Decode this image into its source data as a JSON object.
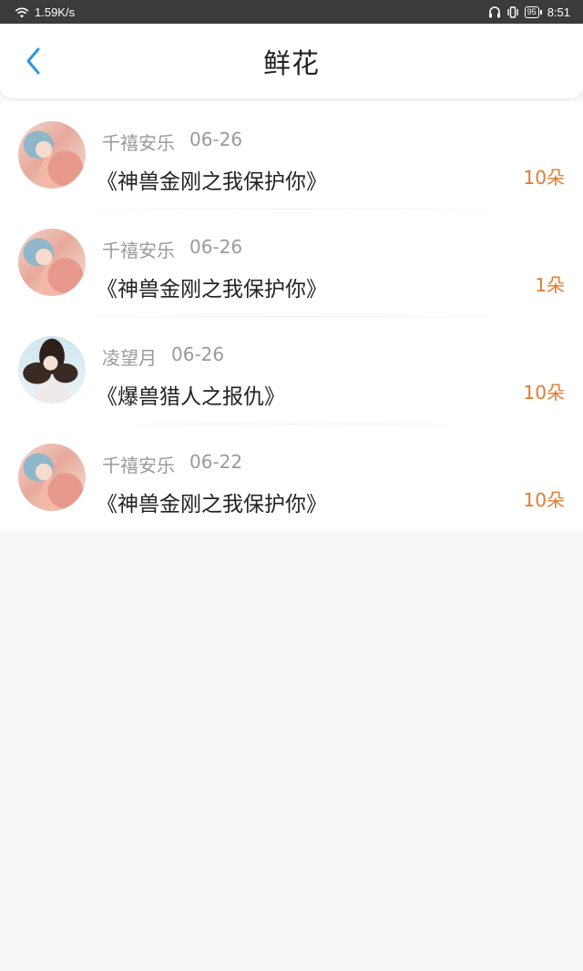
{
  "status_bar": {
    "net_speed": "1.59K/s",
    "battery": "95",
    "time": "8:51"
  },
  "header": {
    "title": "鲜花"
  },
  "list": [
    {
      "user": "千禧安乐",
      "date": "06-26",
      "book": "《神兽金刚之我保护你》",
      "count": "10朵"
    },
    {
      "user": "千禧安乐",
      "date": "06-26",
      "book": "《神兽金刚之我保护你》",
      "count": "1朵"
    },
    {
      "user": "凌望月",
      "date": "06-26",
      "book": "《爆兽猎人之报仇》",
      "count": "10朵"
    },
    {
      "user": "千禧安乐",
      "date": "06-22",
      "book": "《神兽金刚之我保护你》",
      "count": "10朵"
    }
  ],
  "colors": {
    "accent_blue": "#2d96e6",
    "count_orange": "#e07b2e",
    "status_bar_bg": "#3b3b3b"
  },
  "icons": {
    "back": "chevron-left-icon",
    "wifi": "wifi-icon",
    "headphones": "headphones-icon",
    "vibrate": "vibrate-icon",
    "battery": "battery-icon"
  }
}
